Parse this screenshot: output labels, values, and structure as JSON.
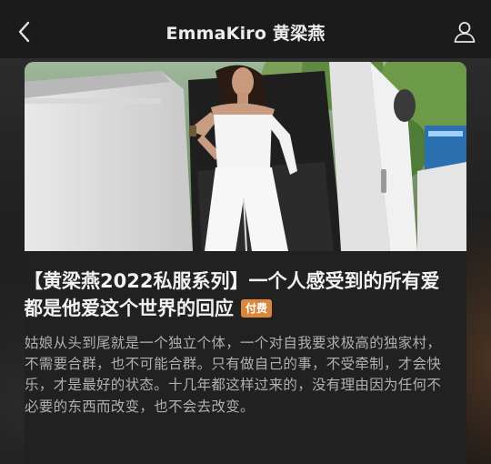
{
  "nav": {
    "title": "EmmaKiro 黄梁燕"
  },
  "article": {
    "title": "【黄梁燕2022私服系列】一个人感受到的所有爱 都是他爱这个世界的回应",
    "badge": "付费",
    "description": "姑娘从头到尾就是一个独立个体，一个对自我要求极高的独家村，不需要合群，也不可能合群。只有做自己的事，不受牵制，才会快乐，才是最好的状态。十几年都这样过来的，没有理由因为任何不必要的东西而改变，也不会去改变。"
  },
  "colors": {
    "badge": "#d8873c",
    "card": "#212121",
    "nav_bg": "#1b1b1b"
  },
  "icons": [
    "back-icon",
    "profile-icon"
  ]
}
